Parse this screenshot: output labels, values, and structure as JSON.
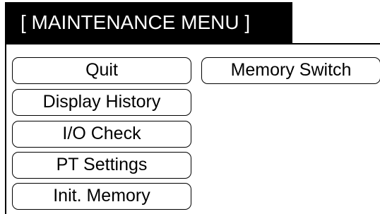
{
  "title": "[ MAINTENANCE MENU ]",
  "menu": {
    "quit": "Quit",
    "memory_switch": "Memory Switch",
    "display_history": "Display History",
    "io_check": "I/O Check",
    "pt_settings": "PT Settings",
    "init_memory": "Init. Memory"
  }
}
